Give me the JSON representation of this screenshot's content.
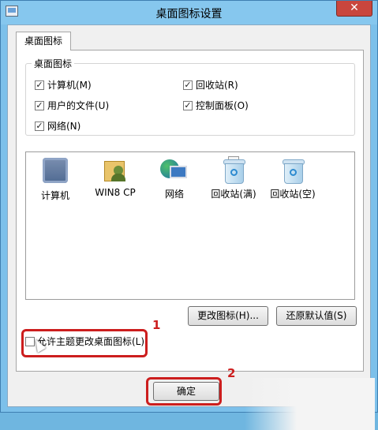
{
  "window": {
    "title": "桌面图标设置",
    "close_glyph": "✕"
  },
  "tabs": [
    {
      "label": "桌面图标",
      "selected": true
    }
  ],
  "desktop_icons_group": {
    "legend": "桌面图标",
    "checkboxes": [
      {
        "label": "计算机(M)",
        "checked": true
      },
      {
        "label": "回收站(R)",
        "checked": true
      },
      {
        "label": "用户的文件(U)",
        "checked": true
      },
      {
        "label": "控制面板(O)",
        "checked": true
      },
      {
        "label": "网络(N)",
        "checked": true
      }
    ]
  },
  "icon_list": [
    {
      "label": "计算机",
      "icon": "computer-icon"
    },
    {
      "label": "WIN8 CP",
      "icon": "user-folder-icon"
    },
    {
      "label": "网络",
      "icon": "network-icon"
    },
    {
      "label": "回收站(满)",
      "icon": "recycle-bin-full-icon"
    },
    {
      "label": "回收站(空)",
      "icon": "recycle-bin-empty-icon"
    }
  ],
  "buttons": {
    "change_icon": "更改图标(H)...",
    "restore_default": "还原默认值(S)",
    "ok": "确定"
  },
  "allow_themes": {
    "label": "允许主题更改桌面图标(L)",
    "checked": false
  },
  "annotations": [
    {
      "number": "1"
    },
    {
      "number": "2"
    }
  ],
  "colors": {
    "annotation_red": "#cc1e1e",
    "titlebar": "#86c7ee",
    "close_button": "#c9463d"
  }
}
